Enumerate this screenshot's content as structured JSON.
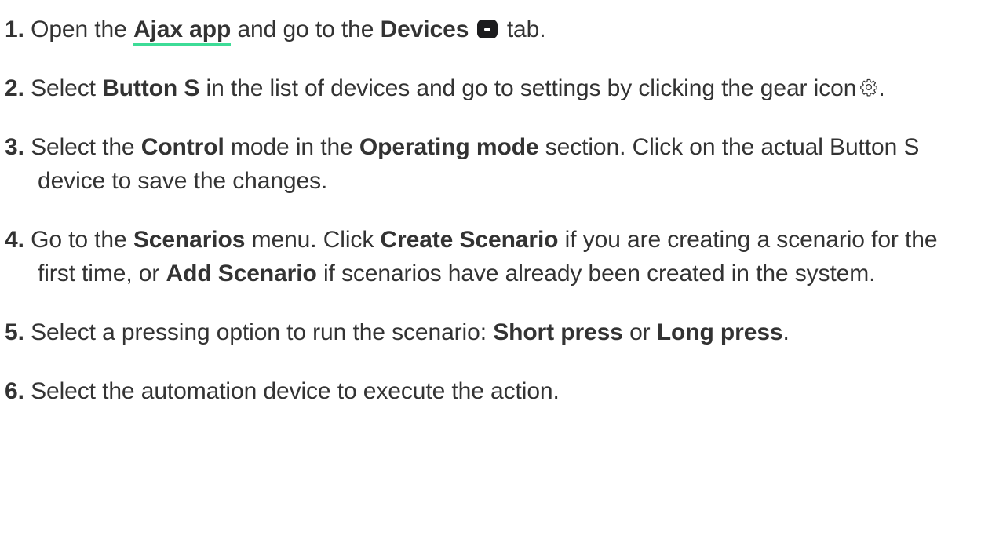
{
  "steps": [
    {
      "num": "1.",
      "parts": [
        "Open the",
        "Ajax app",
        "and go to the",
        "Devices",
        "tab."
      ],
      "icon": "devices-icon"
    },
    {
      "num": "2.",
      "parts": [
        "Select",
        "Button S",
        "in the list of devices and go to settings by clicking the gear icon",
        "."
      ],
      "icon": "gear-icon"
    },
    {
      "num": "3.",
      "parts": [
        "Select the",
        "Control",
        "mode in the",
        "Operating mode",
        "section. Click on the actual Button S device to save the changes."
      ]
    },
    {
      "num": "4.",
      "parts": [
        "Go to the",
        "Scenarios",
        "menu. Click",
        "Create Scenario",
        "if you are creating a scenario for the first time, or",
        "Add Scenario",
        "if scenarios have already been created in the system."
      ]
    },
    {
      "num": "5.",
      "parts": [
        "Select a pressing option to run the scenario:",
        "Short press",
        "or",
        "Long press",
        "."
      ]
    },
    {
      "num": "6.",
      "parts": [
        "Select the automation device to execute the action."
      ]
    }
  ],
  "colors": {
    "text": "#333333",
    "link_underline": "#3ddc97",
    "icon_fill": "#1c1c1e"
  }
}
